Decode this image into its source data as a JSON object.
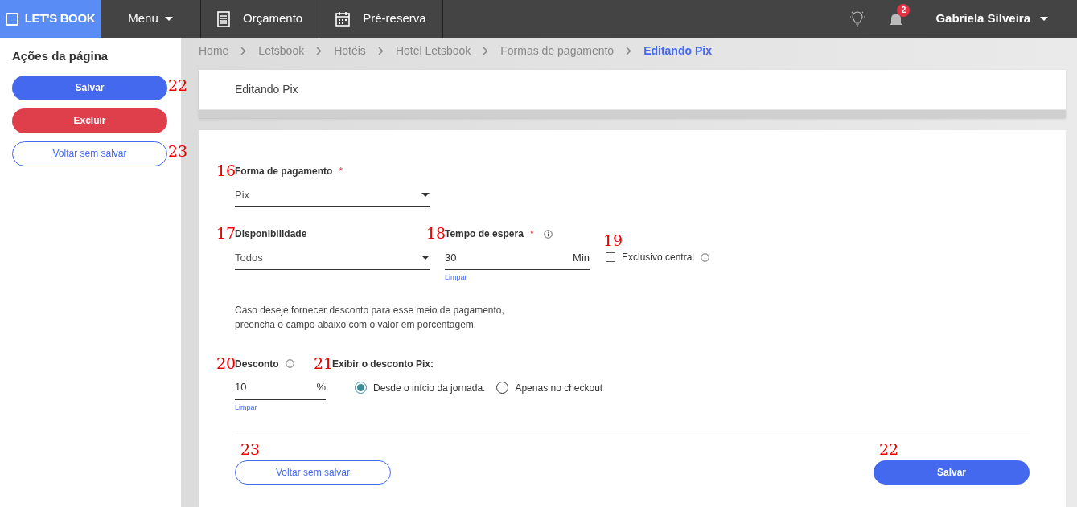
{
  "navbar": {
    "logo": "LET'S BOOK",
    "menu": "Menu",
    "links": [
      {
        "kind": "document",
        "label": "Orçamento"
      },
      {
        "kind": "calendar",
        "label": "Pré-reserva"
      }
    ],
    "notification_count": "2",
    "user": "Gabriela Silveira"
  },
  "sidebar": {
    "title": "Ações da página",
    "buttons": [
      {
        "kind": "primary",
        "label": "Salvar",
        "marker": "22"
      },
      {
        "kind": "danger",
        "label": "Excluir"
      },
      {
        "kind": "outline",
        "label": "Voltar sem salvar",
        "marker": "23"
      }
    ]
  },
  "breadcrumb": [
    {
      "label": "Home",
      "selected": false
    },
    {
      "label": "Letsbook",
      "selected": false
    },
    {
      "label": "Hotéis",
      "selected": false
    },
    {
      "label": "Hotel Letsbook",
      "selected": false
    },
    {
      "label": "Formas de pagamento",
      "selected": false
    },
    {
      "label": "Editando Pix",
      "selected": true
    }
  ],
  "page_title": "Editando Pix",
  "form": {
    "payment_method": {
      "marker": "16",
      "label": "Forma de pagamento",
      "required_mark": "*",
      "value": "Pix"
    },
    "availability": {
      "marker": "17",
      "label": "Disponibilidade",
      "value": "Todos"
    },
    "wait_time": {
      "marker": "18",
      "label": "Tempo de espera",
      "required_mark": "*",
      "value": "30",
      "suffix": "Min",
      "clear": "Limpar"
    },
    "exclusive": {
      "marker": "19",
      "label": "Exclusivo central",
      "checked": false
    },
    "hint": "Caso deseje fornecer desconto para esse meio de pagamento,\npreencha o campo abaixo com o valor em porcentagem.",
    "discount": {
      "marker": "20",
      "label": "Desconto",
      "value": "10",
      "suffix": "%",
      "clear": "Limpar"
    },
    "show_discount": {
      "marker": "21",
      "label": "Exibir o desconto Pix:",
      "options": [
        {
          "label": "Desde o início da jornada.",
          "selected": true
        },
        {
          "label": "Apenas no checkout",
          "selected": false
        }
      ]
    },
    "buttons": [
      {
        "kind": "outline",
        "label": "Voltar sem salvar",
        "marker": "23"
      },
      {
        "kind": "primary",
        "label": "Salvar",
        "marker": "22"
      }
    ]
  }
}
